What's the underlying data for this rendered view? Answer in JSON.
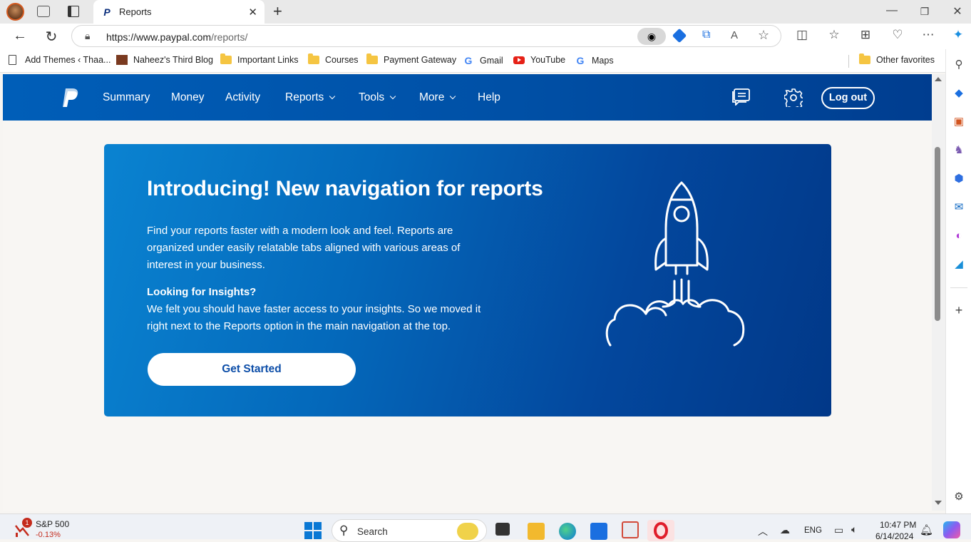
{
  "browser": {
    "tab_title": "Reports",
    "url_host": "https://www.paypal.com",
    "url_path": "/reports/",
    "favorites": [
      {
        "label": "Add Themes ‹ Thaa...",
        "icon": "page-icon"
      },
      {
        "label": "Naheez's Third Blog",
        "icon": "blog-icon"
      },
      {
        "label": "Important Links",
        "icon": "folder-icon"
      },
      {
        "label": "Courses",
        "icon": "folder-icon"
      },
      {
        "label": "Payment Gateway",
        "icon": "folder-icon"
      },
      {
        "label": "Gmail",
        "icon": "google-icon"
      },
      {
        "label": "YouTube",
        "icon": "youtube-icon"
      },
      {
        "label": "Maps",
        "icon": "google-icon"
      }
    ],
    "other_favorites": "Other favorites"
  },
  "paypal_nav": {
    "items": [
      "Summary",
      "Money",
      "Activity",
      "Reports",
      "Tools",
      "More",
      "Help"
    ],
    "logout": "Log out"
  },
  "banner": {
    "title": "Introducing! New navigation for reports",
    "description": "Find your reports faster with a modern look and feel. Reports are organized under easily relatable tabs aligned with various areas of interest in your business.",
    "insights_heading": "Looking for Insights?",
    "insights_text": "We felt you should have faster access to your insights. So we moved it right next to the Reports option in the main navigation at the top.",
    "cta": "Get Started"
  },
  "taskbar": {
    "stock_name": "S&P 500",
    "stock_change": "-0.13%",
    "notification_count": "1",
    "search_placeholder": "Search",
    "language": "ENG",
    "time": "10:47 PM",
    "date": "6/14/2024"
  },
  "colors": {
    "paypal_nav": "#0050a6",
    "banner_start": "#0a83d1",
    "banner_end": "#013888",
    "cta_text": "#0d4ea8"
  }
}
